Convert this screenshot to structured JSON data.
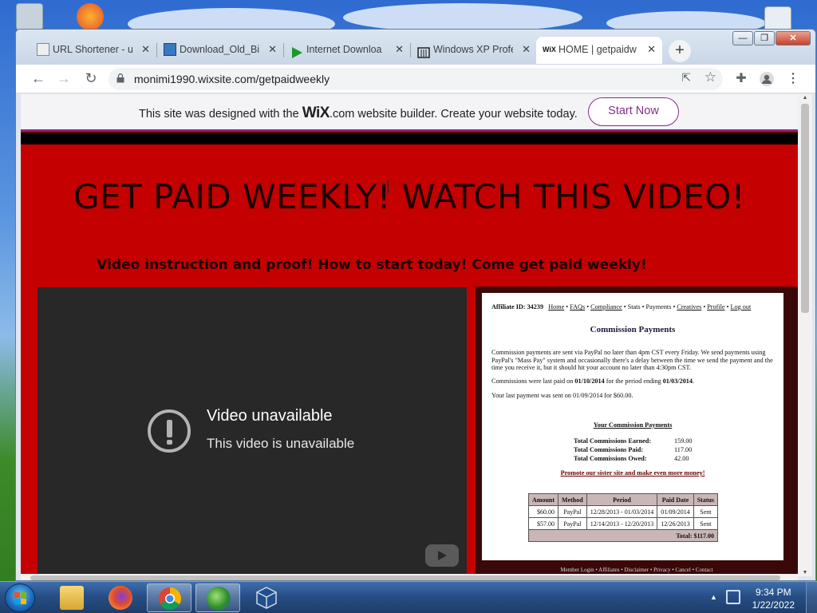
{
  "browser": {
    "tabs": [
      {
        "label": "URL Shortener - ul",
        "icon": "url-shortener-icon"
      },
      {
        "label": "Download_Old_Bi",
        "icon": "picture-icon"
      },
      {
        "label": "Internet Downloa",
        "icon": "green-play-icon"
      },
      {
        "label": "Windows XP Profe",
        "icon": "archive-icon"
      },
      {
        "label": "HOME | getpaidw",
        "icon": "wix-icon",
        "favicon_text": "WiX",
        "active": true
      }
    ],
    "tab_close": "✕",
    "new_tab": "+",
    "url": "monimi1990.wixsite.com/getpaidweekly",
    "window_controls": {
      "minimize": "—",
      "maximize": "❐",
      "close": "✕"
    }
  },
  "wix_banner": {
    "text_before": "This site was designed with the ",
    "brand": "WiX",
    "text_after": ".com website builder. Create your website today.",
    "button": "Start Now"
  },
  "page": {
    "headline": "GET PAID WEEKLY! WATCH THIS VIDEO!",
    "subheadline": "Video instruction and proof! How to start today! Come get paid weekly!",
    "video": {
      "title": "Video unavailable",
      "subtitle": "This video is unavailable"
    },
    "proof": {
      "affiliate_label": "Affiliate ID: 34239",
      "nav_links": [
        "Home",
        "FAQs",
        "Compliance",
        "Stats",
        "Payments",
        "Creatives",
        "Profile",
        "Log out"
      ],
      "heading": "Commission Payments",
      "para1": "Commission payments are sent via PayPal no later than 4pm CST every Friday. We send payments using PayPal's \"Mass Pay\" system and occasionally there's a delay between the time we send the payment and the time you receive it, but it should hit your account no later than 4:30pm CST.",
      "para2_a": "Commissions were last paid on ",
      "para2_date": "01/10/2014",
      "para2_b": " for the period ending ",
      "para2_end": "01/03/2014",
      "para2_c": ".",
      "para3": "Your last payment was sent on 01/09/2014 for $60.00.",
      "your_heading": "Your Commission Payments",
      "totals": [
        {
          "label": "Total Commissions Earned:",
          "value": "159.00"
        },
        {
          "label": "Total Commissions Paid:",
          "value": "117.00"
        },
        {
          "label": "Total Commissions Owed:",
          "value": "42.00"
        }
      ],
      "promo": "Promote our sister site and make even more money!",
      "table": {
        "headers": [
          "Amount",
          "Method",
          "Period",
          "Paid Date",
          "Status"
        ],
        "rows": [
          [
            "$60.00",
            "PayPal",
            "12/28/2013 - 01/03/2014",
            "01/09/2014",
            "Sent"
          ],
          [
            "$57.00",
            "PayPal",
            "12/14/2013 - 12/20/2013",
            "12/26/2013",
            "Sent"
          ]
        ],
        "total": "Total: $117.00"
      },
      "footer": "Member Login • Affiliates • Disclaimer • Privacy • Cancel • Contact"
    }
  },
  "taskbar": {
    "apps": [
      "explorer-icon",
      "firefox-icon",
      "chrome-icon",
      "idm-globe-icon",
      "virtualbox-icon"
    ],
    "time": "9:34 PM",
    "date": "1/22/2022"
  },
  "colors": {
    "page_red": "#c40000",
    "wix_purple": "#8a2c8c",
    "video_bg": "#282828"
  }
}
